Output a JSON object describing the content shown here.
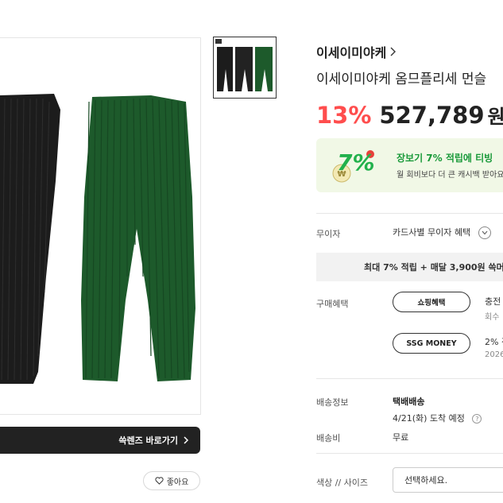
{
  "product": {
    "brand": "이세이미야케",
    "name": "이세이미야케 옴므플리세 먼슬",
    "discount": "13%",
    "price": "527,789",
    "price_unit": "원",
    "price_trail": "("
  },
  "promo": {
    "title": "장보기 7% 적립에 티빙",
    "subtitle": "월 회비보다 더 큰 캐시백 받아요",
    "badge": "7%"
  },
  "rows": {
    "muija_label": "무이자",
    "muija_value": "카드사별 무이자 혜택",
    "benefit_strip": "최대 7% 적립 + 매달 3,900원 쓱머",
    "purchase_label": "구매혜택",
    "shopping_pill": "쇼핑혜택",
    "shopping_text": "충전",
    "shopping_sub": "회수",
    "ssg_pill": "SSG MONEY",
    "ssg_text": "2% 적",
    "ssg_sub": "2026",
    "shipping_label": "배송정보",
    "shipping_type": "택배배송",
    "shipping_date": "4/21(화) 도착 예정",
    "shipping_fee_label": "배송비",
    "shipping_fee": "무료",
    "option_label": "색상 // 사이즈",
    "option_placeholder": "선택하세요."
  },
  "image_actions": {
    "sslens": "쓱렌즈 바로가기",
    "like": "좋아요"
  },
  "colors": {
    "discount": "#ff4d4d",
    "promo_bg": "#f1f8e6",
    "promo_green": "#1a9a3a",
    "pants_black": "#1c1c1c",
    "pants_green": "#1d5a2b"
  },
  "icons": {
    "brand_chevron": "chevron-right-icon",
    "card_chevron": "chevron-down-circle-icon",
    "help": "question-circle-icon",
    "heart": "heart-icon",
    "sslens_chevron": "chevron-right-icon"
  }
}
